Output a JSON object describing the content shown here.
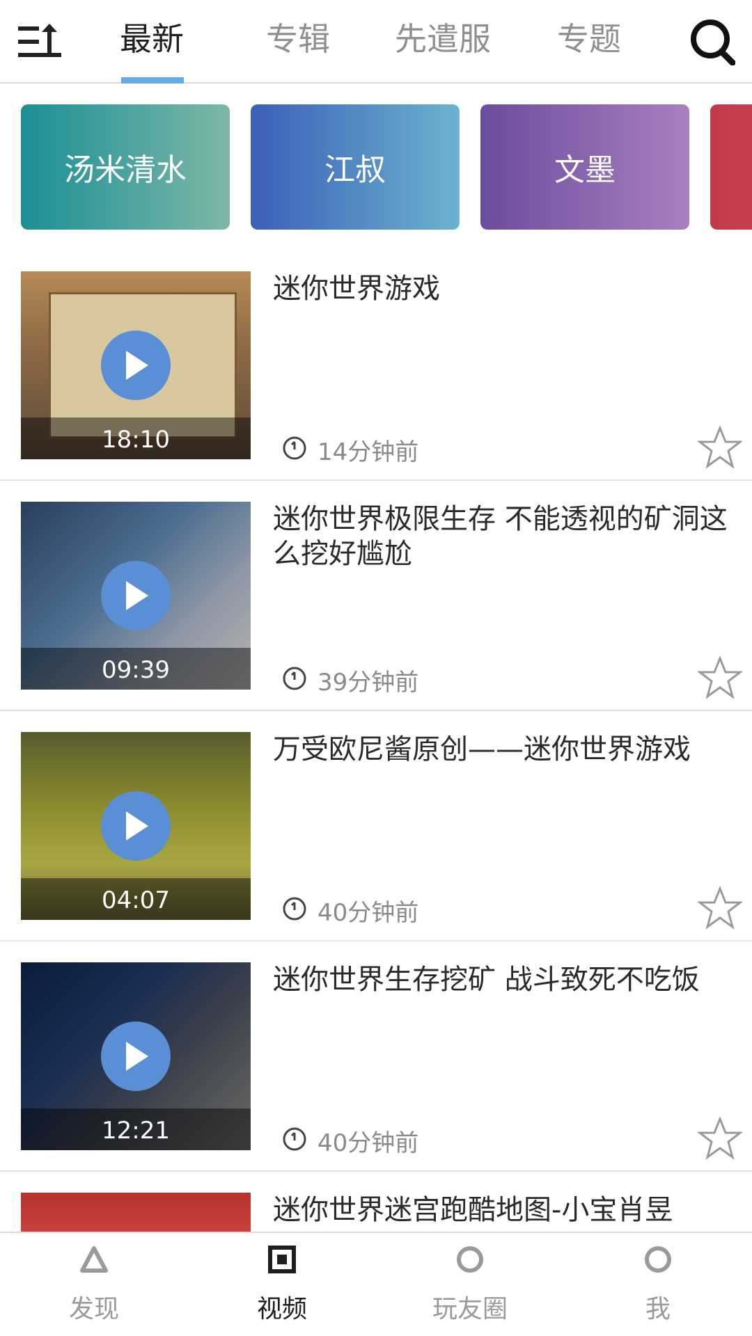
{
  "header": {
    "tabs": [
      {
        "label": "最新",
        "active": true
      },
      {
        "label": "专辑",
        "active": false
      },
      {
        "label": "先遣服",
        "active": false
      },
      {
        "label": "专题",
        "active": false
      }
    ],
    "accent_color": "#64a8e6"
  },
  "categories": [
    {
      "label": "汤米清水"
    },
    {
      "label": "江叔"
    },
    {
      "label": "文墨"
    },
    {
      "label": ""
    }
  ],
  "videos": [
    {
      "title": "迷你世界游戏",
      "duration": "18:10",
      "time": "14分钟前"
    },
    {
      "title": "迷你世界极限生存 不能透视的矿洞这么挖好尴尬",
      "duration": "09:39",
      "time": "39分钟前"
    },
    {
      "title": "万受欧尼酱原创——迷你世界游戏",
      "duration": "04:07",
      "time": "40分钟前"
    },
    {
      "title": "迷你世界生存挖矿 战斗致死不吃饭",
      "duration": "12:21",
      "time": "40分钟前"
    },
    {
      "title": "迷你世界迷宫跑酷地图-小宝肖昱",
      "duration": "",
      "time": ""
    }
  ],
  "bottom_nav": [
    {
      "label": "发现",
      "icon": "triangle-icon",
      "active": false
    },
    {
      "label": "视频",
      "icon": "square-icon",
      "active": true
    },
    {
      "label": "玩友圈",
      "icon": "circle-icon",
      "active": false
    },
    {
      "label": "我",
      "icon": "circle-icon",
      "active": false
    }
  ]
}
